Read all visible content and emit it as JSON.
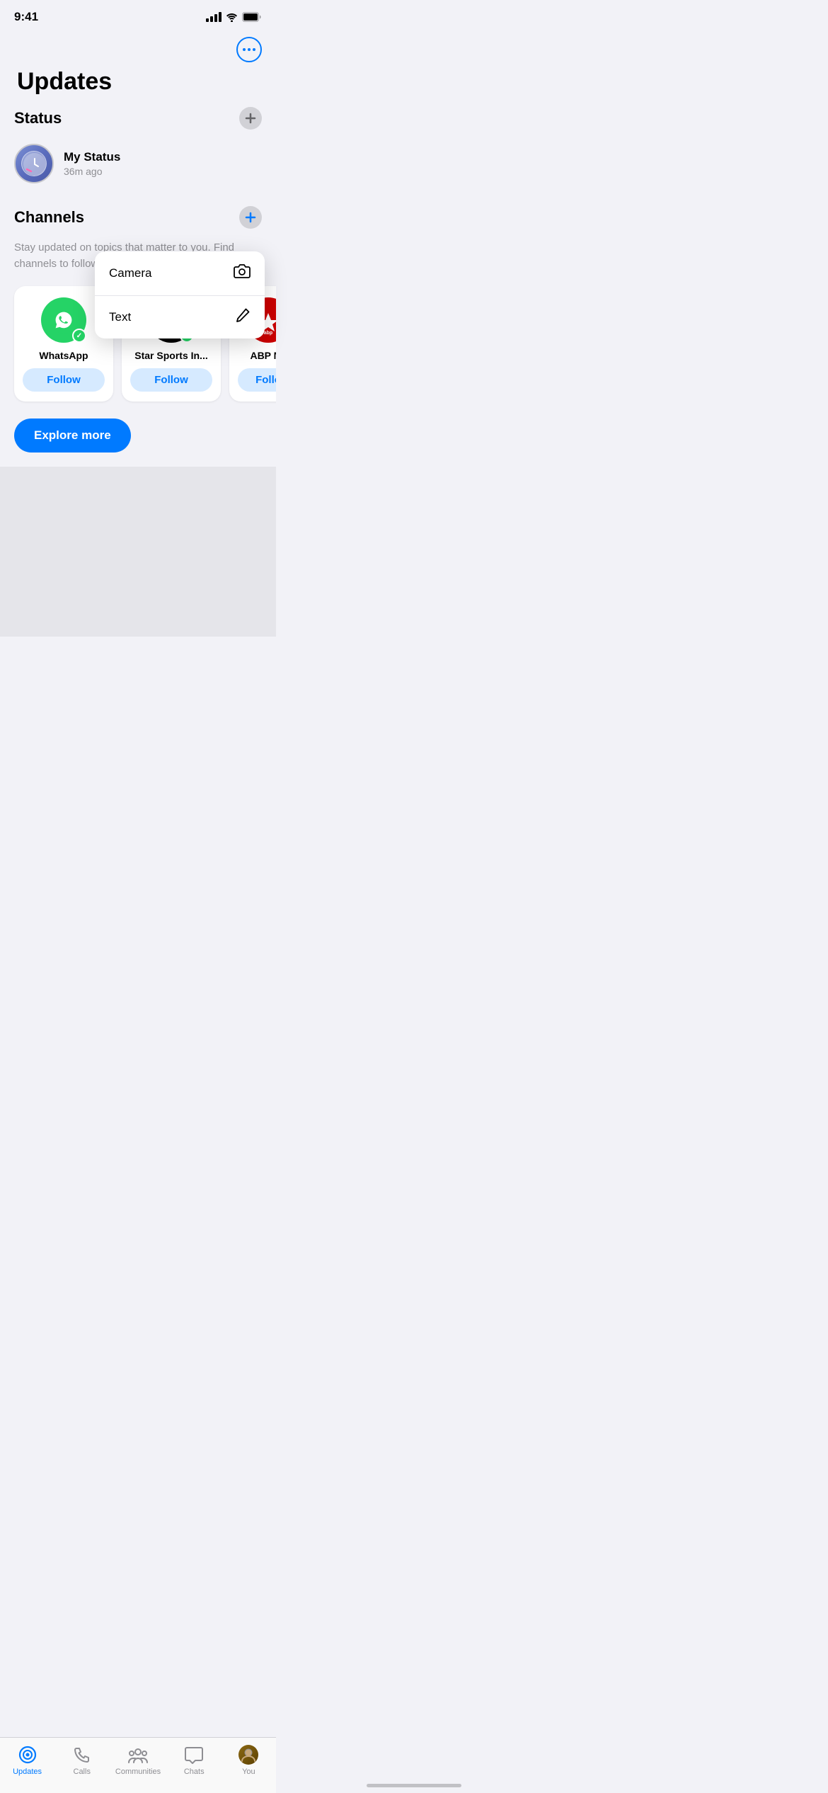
{
  "statusBar": {
    "time": "9:41",
    "signalBars": 4,
    "wifi": true,
    "battery": "full"
  },
  "header": {
    "moreButton": "more-options",
    "pageTitle": "Updates"
  },
  "statusSection": {
    "sectionTitle": "Status",
    "addButton": "+",
    "myStatus": {
      "name": "My Sta",
      "timeAgo": "36m ag"
    }
  },
  "dropdownMenu": {
    "items": [
      {
        "label": "Camera",
        "icon": "camera"
      },
      {
        "label": "Text",
        "icon": "pencil"
      }
    ]
  },
  "channelsSection": {
    "sectionTitle": "Channels",
    "addButton": "+",
    "description": "Stay updated on topics that matter to you. Find channels to follow below.",
    "channels": [
      {
        "id": "whatsapp",
        "name": "WhatsApp",
        "followLabel": "Follow",
        "verified": true
      },
      {
        "id": "starsports",
        "name": "Star Sports In...",
        "followLabel": "Follow",
        "verified": true
      },
      {
        "id": "abpnews",
        "name": "ABP Ne",
        "followLabel": "Follo",
        "verified": true
      }
    ],
    "exploreMoreLabel": "Explore more"
  },
  "tabBar": {
    "tabs": [
      {
        "id": "updates",
        "label": "Updates",
        "icon": "updates",
        "active": true
      },
      {
        "id": "calls",
        "label": "Calls",
        "icon": "calls",
        "active": false
      },
      {
        "id": "communities",
        "label": "Communities",
        "icon": "communities",
        "active": false
      },
      {
        "id": "chats",
        "label": "Chats",
        "icon": "chats",
        "active": false
      },
      {
        "id": "you",
        "label": "You",
        "icon": "you",
        "active": false
      }
    ]
  }
}
